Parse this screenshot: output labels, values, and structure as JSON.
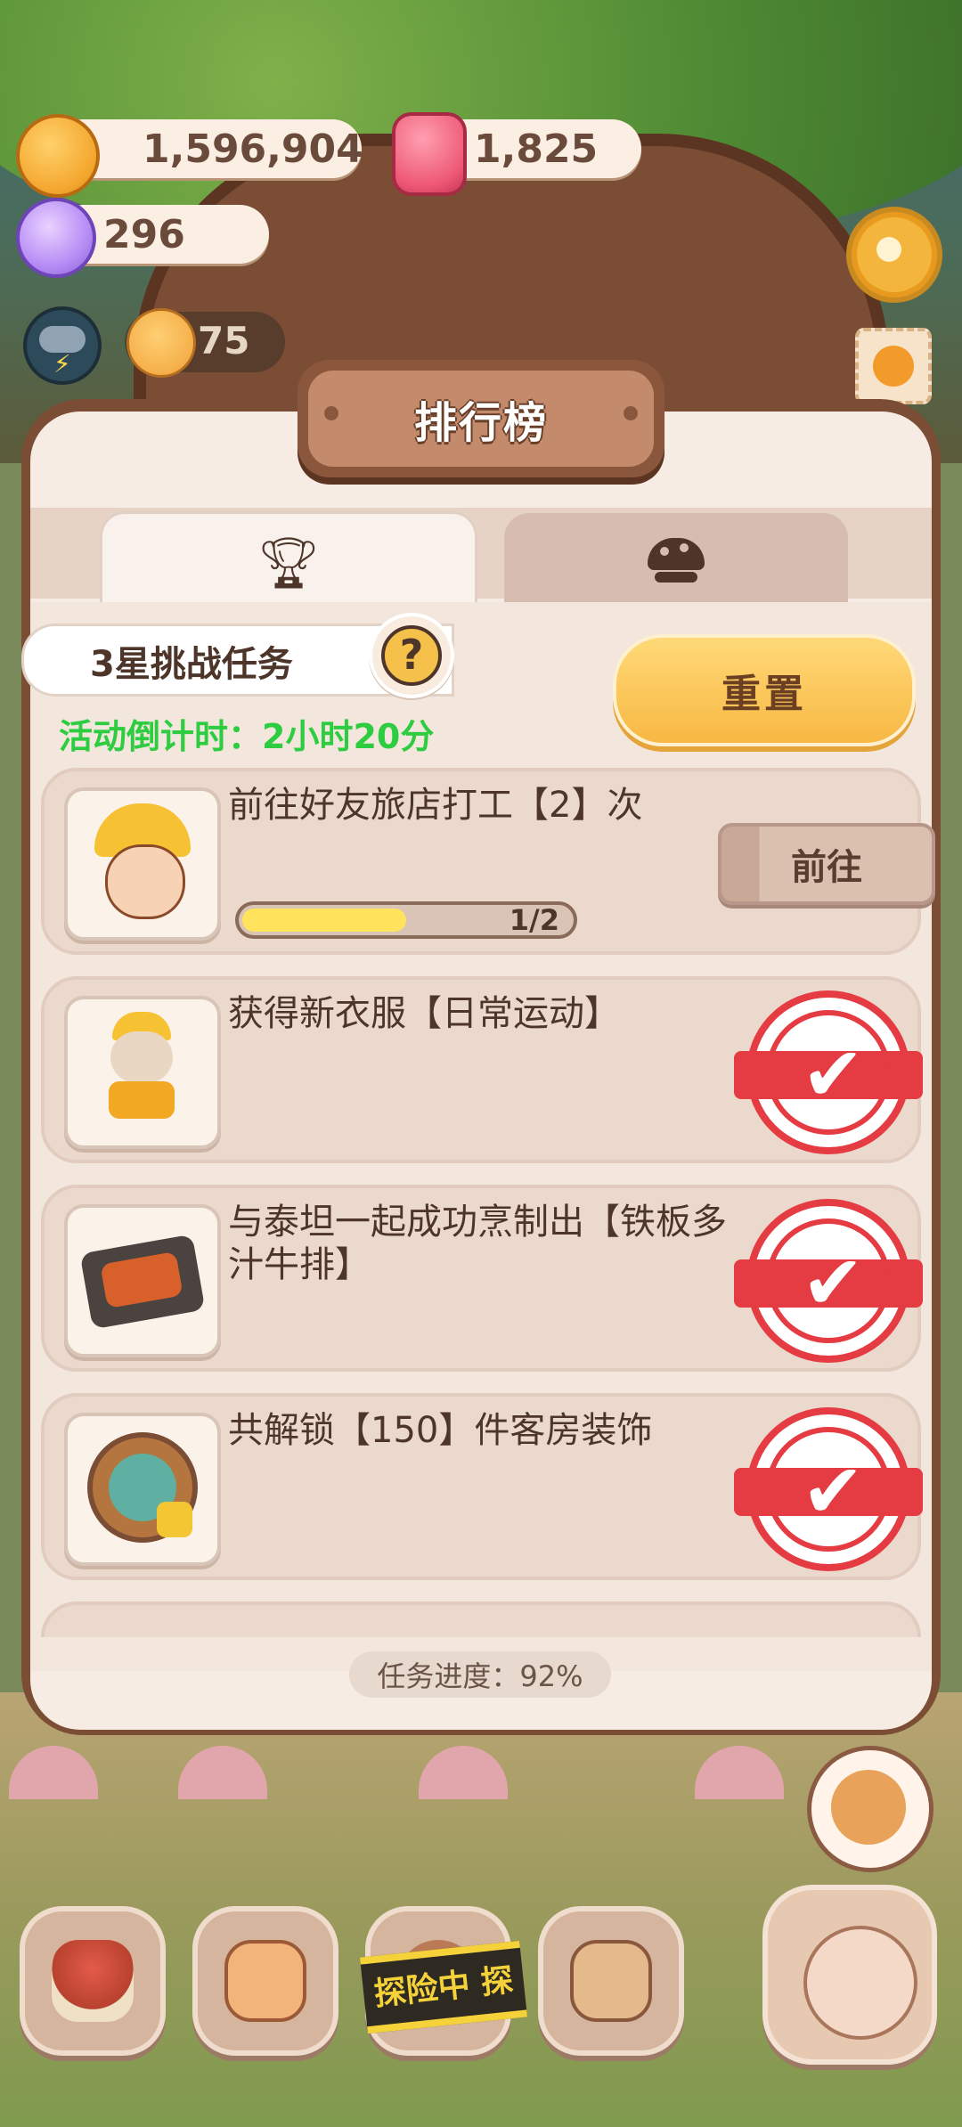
{
  "resources": {
    "cookies": "1,596,904",
    "candles": "1,825",
    "gems": "296",
    "level": "75"
  },
  "panel": {
    "title": "排行榜",
    "tabs": [
      {
        "icon": "trophy-icon",
        "active": true
      },
      {
        "icon": "mushroom-cake-icon",
        "active": false
      }
    ],
    "challenge_label": "3星挑战任务",
    "help_symbol": "?",
    "countdown": "活动倒计时：2小时20分",
    "reset_label": "重置",
    "tasks": [
      {
        "title": "前往好友旅店打工【2】次",
        "progress": {
          "current": 1,
          "total": 2,
          "label": "1/2"
        },
        "action": "前往",
        "completed": false
      },
      {
        "title": "获得新衣服【日常运动】",
        "completed": true
      },
      {
        "title": "与泰坦一起成功烹制出【铁板多汁牛排】",
        "completed": true
      },
      {
        "title": "共解锁【150】件客房装饰",
        "completed": true
      }
    ],
    "overall_progress": "任务进度：92%"
  },
  "bottom_bar": {
    "exploring_label": "探险中 探"
  },
  "colors": {
    "panel_frame": "#7b4d34",
    "panel_bg": "#f6ece3",
    "countdown": "#2ecc40",
    "reset_button": "#f8b843",
    "stamp": "#e53b42",
    "progress_fill": "#ffe35c"
  }
}
